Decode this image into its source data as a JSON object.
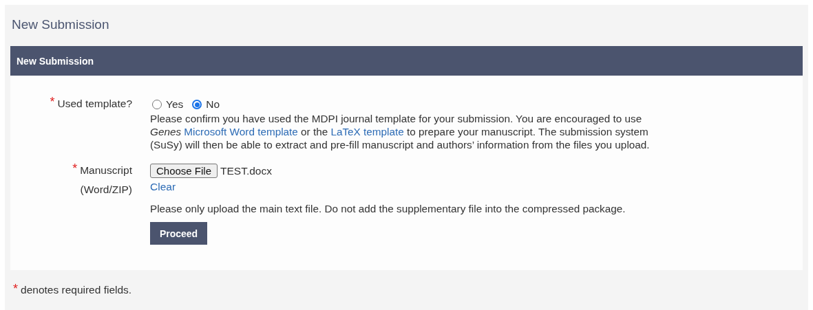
{
  "page_title": "New Submission",
  "panel": {
    "title": "New Submission",
    "used_template": {
      "label": "Used template?",
      "required_mark": "*",
      "options": [
        {
          "label": "Yes",
          "selected": false
        },
        {
          "label": "No",
          "selected": true
        }
      ],
      "help": [
        {
          "kind": "text",
          "text": "Please confirm you have used the MDPI journal template for your submission. You are encouraged to use *Genes* "
        },
        {
          "kind": "link",
          "text": "Microsoft Word template"
        },
        {
          "kind": "text",
          "text": " or the "
        },
        {
          "kind": "link",
          "text": "LaTeX template"
        },
        {
          "kind": "text",
          "text": " to prepare your manuscript. The submission system (SuSy) will then be able to extract and pre-fill manuscript and authors’ information from the files you upload."
        }
      ]
    },
    "manuscript": {
      "label_lines": [
        "Manuscript",
        "(Word/ZIP)"
      ],
      "required_mark": "*",
      "file_button": "Choose File",
      "file_name": "TEST.docx",
      "clear_link": "Clear",
      "note": "Please only upload the main text file. Do not add the supplementary file into the compressed package.",
      "submit": "Proceed"
    }
  },
  "footer": {
    "required_mark": "*",
    "text": "denotes required fields."
  }
}
